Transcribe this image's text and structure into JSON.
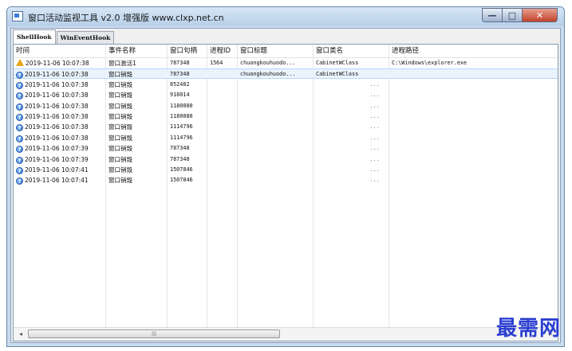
{
  "window": {
    "title": "窗口活动监视工具 v2.0 增强版 www.clxp.net.cn",
    "buttons": {
      "minimize": "—",
      "maximize": "□",
      "close": "✕"
    }
  },
  "tabs": [
    {
      "label": "ShellHook",
      "active": true
    },
    {
      "label": "WinEventHook",
      "active": false
    }
  ],
  "table": {
    "columns": [
      "时间",
      "事件名称",
      "窗口句柄",
      "进程ID",
      "窗口标题",
      "窗口类名",
      "进程路径"
    ],
    "rows": [
      {
        "icon": "warning-icon",
        "time": "2019-11-06 10:07:38",
        "event": "窗口激活1",
        "handle": "787348",
        "pid": "1564",
        "title": "chuangkouhuodo...",
        "class": "CabinetWClass",
        "path": "C:\\Windows\\explorer.exe"
      },
      {
        "icon": "help-icon",
        "time": "2019-11-06 10:07:38",
        "event": "窗口销毁",
        "handle": "787348",
        "pid": "",
        "title": "chuangkouhuodo...",
        "class": "CabinetWClass",
        "path": "",
        "selected": true
      },
      {
        "icon": "help-icon",
        "time": "2019-11-06 10:07:38",
        "event": "窗口销毁",
        "handle": "852482",
        "pid": "",
        "title": "",
        "class": "...",
        "path": ""
      },
      {
        "icon": "help-icon",
        "time": "2019-11-06 10:07:38",
        "event": "窗口销毁",
        "handle": "918014",
        "pid": "",
        "title": "",
        "class": "...",
        "path": ""
      },
      {
        "icon": "help-icon",
        "time": "2019-11-06 10:07:38",
        "event": "窗口销毁",
        "handle": "1180080",
        "pid": "",
        "title": "",
        "class": "...",
        "path": ""
      },
      {
        "icon": "help-icon",
        "time": "2019-11-06 10:07:38",
        "event": "窗口销毁",
        "handle": "1180080",
        "pid": "",
        "title": "",
        "class": "...",
        "path": ""
      },
      {
        "icon": "help-icon",
        "time": "2019-11-06 10:07:38",
        "event": "窗口销毁",
        "handle": "1114796",
        "pid": "",
        "title": "",
        "class": "...",
        "path": ""
      },
      {
        "icon": "help-icon",
        "time": "2019-11-06 10:07:38",
        "event": "窗口销毁",
        "handle": "1114796",
        "pid": "",
        "title": "",
        "class": "...",
        "path": ""
      },
      {
        "icon": "help-icon",
        "time": "2019-11-06 10:07:39",
        "event": "窗口销毁",
        "handle": "787348",
        "pid": "",
        "title": "",
        "class": "...",
        "path": ""
      },
      {
        "icon": "help-icon",
        "time": "2019-11-06 10:07:39",
        "event": "窗口销毁",
        "handle": "787348",
        "pid": "",
        "title": "",
        "class": "...",
        "path": ""
      },
      {
        "icon": "help-icon",
        "time": "2019-11-06 10:07:41",
        "event": "窗口销毁",
        "handle": "1507846",
        "pid": "",
        "title": "",
        "class": "...",
        "path": ""
      },
      {
        "icon": "help-icon",
        "time": "2019-11-06 10:07:41",
        "event": "窗口销毁",
        "handle": "1507846",
        "pid": "",
        "title": "",
        "class": "...",
        "path": ""
      }
    ]
  },
  "scrollbar": {
    "thumb_grip": "|||"
  },
  "watermark": "最需网",
  "colors": {
    "selection": "#eaf3fc",
    "close_button": "#c2412a",
    "watermark": "#2b3fd0"
  }
}
